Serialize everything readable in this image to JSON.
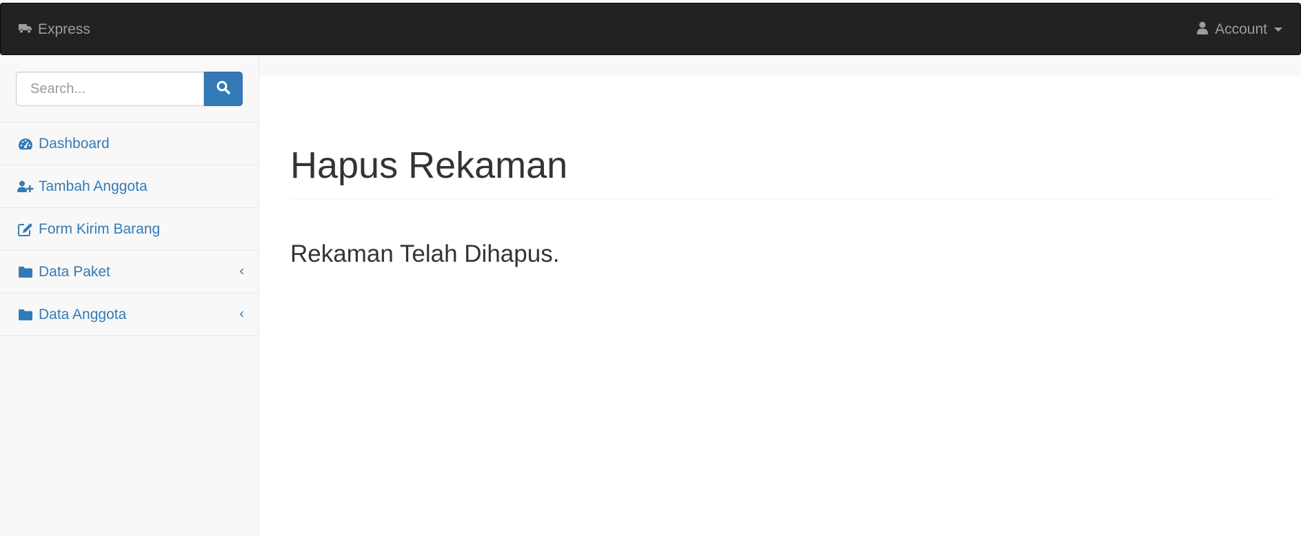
{
  "navbar": {
    "brand_label": "Express",
    "brand_icon": "truck-icon",
    "account_label": "Account",
    "account_icon": "user-icon"
  },
  "sidebar": {
    "search": {
      "placeholder": "Search...",
      "value": ""
    },
    "items": [
      {
        "label": "Dashboard",
        "icon": "tachometer-icon",
        "has_submenu": false
      },
      {
        "label": "Tambah Anggota",
        "icon": "user-plus-icon",
        "has_submenu": false
      },
      {
        "label": "Form Kirim Barang",
        "icon": "edit-icon",
        "has_submenu": false
      },
      {
        "label": "Data Paket",
        "icon": "folder-icon",
        "has_submenu": true
      },
      {
        "label": "Data Anggota",
        "icon": "folder-icon",
        "has_submenu": true
      }
    ]
  },
  "main": {
    "title": "Hapus Rekaman",
    "message": "Rekaman Telah Dihapus."
  },
  "colors": {
    "navbar_bg": "#222222",
    "navbar_text": "#9d9d9d",
    "link": "#337ab7",
    "primary_button": "#337ab7",
    "sidebar_bg": "#f8f8f8",
    "content_bg": "#ffffff"
  }
}
